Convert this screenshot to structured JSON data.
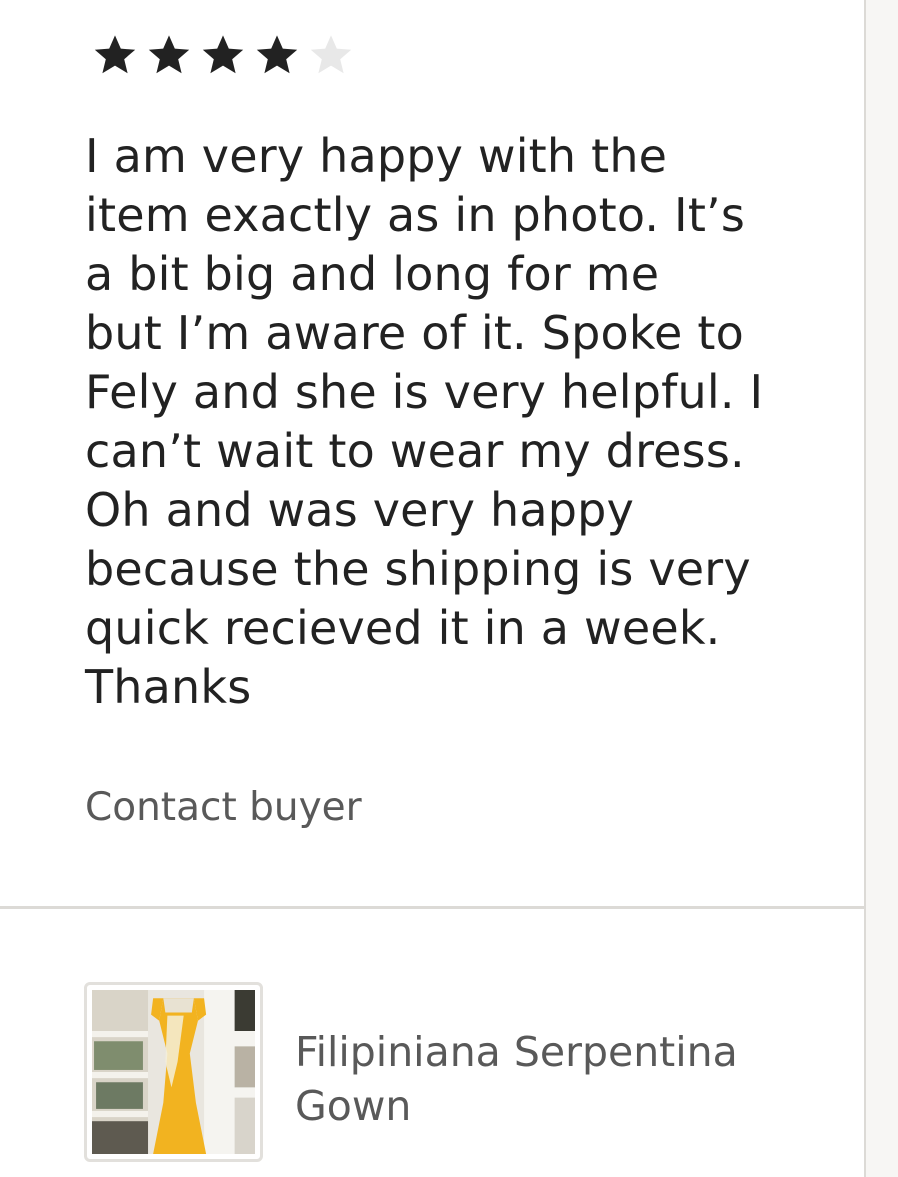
{
  "review": {
    "rating": 4,
    "max_rating": 5,
    "text": "I am very happy with the\nitem exactly as in photo. It’s\na bit big and long for me\nbut I’m aware of it. Spoke to\nFely and she is very helpful. I\ncan’t wait to wear my dress.\nOh and was very happy\nbecause the shipping is very\nquick recieved it in a week.\nThanks"
  },
  "actions": {
    "contact_buyer_label": "Contact buyer"
  },
  "item": {
    "title": "Filipiniana Serpentina Gown"
  },
  "colors": {
    "star_filled": "#222222",
    "star_empty": "#e8e8e8",
    "body_text": "#222222",
    "muted_text": "#595959",
    "divider": "#dcdad6"
  },
  "icons": {
    "filled_star": "star-filled-icon",
    "empty_star": "star-empty-icon"
  }
}
